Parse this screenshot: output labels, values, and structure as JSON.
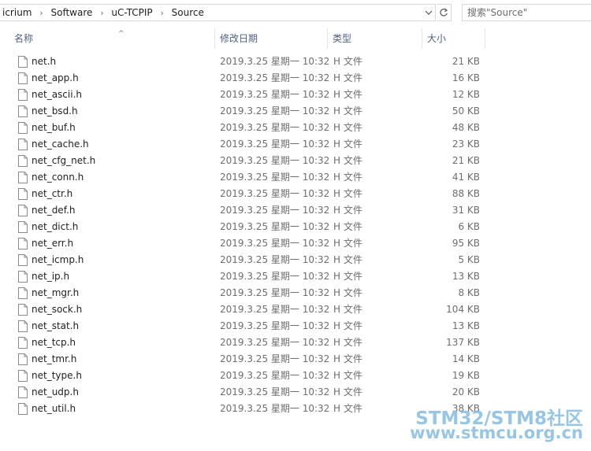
{
  "address_bar": {
    "breadcrumbs": [
      "icrium",
      "Software",
      "uC-TCPIP",
      "Source"
    ]
  },
  "search": {
    "placeholder": "搜索\"Source\""
  },
  "columns": {
    "name": "名称",
    "date": "修改日期",
    "type": "类型",
    "size": "大小"
  },
  "files": [
    {
      "name": "net.h",
      "date": "2019.3.25 星期一 10:32",
      "type": "H 文件",
      "size": "21 KB"
    },
    {
      "name": "net_app.h",
      "date": "2019.3.25 星期一 10:32",
      "type": "H 文件",
      "size": "16 KB"
    },
    {
      "name": "net_ascii.h",
      "date": "2019.3.25 星期一 10:32",
      "type": "H 文件",
      "size": "12 KB"
    },
    {
      "name": "net_bsd.h",
      "date": "2019.3.25 星期一 10:32",
      "type": "H 文件",
      "size": "50 KB"
    },
    {
      "name": "net_buf.h",
      "date": "2019.3.25 星期一 10:32",
      "type": "H 文件",
      "size": "48 KB"
    },
    {
      "name": "net_cache.h",
      "date": "2019.3.25 星期一 10:32",
      "type": "H 文件",
      "size": "23 KB"
    },
    {
      "name": "net_cfg_net.h",
      "date": "2019.3.25 星期一 10:32",
      "type": "H 文件",
      "size": "21 KB"
    },
    {
      "name": "net_conn.h",
      "date": "2019.3.25 星期一 10:32",
      "type": "H 文件",
      "size": "41 KB"
    },
    {
      "name": "net_ctr.h",
      "date": "2019.3.25 星期一 10:32",
      "type": "H 文件",
      "size": "88 KB"
    },
    {
      "name": "net_def.h",
      "date": "2019.3.25 星期一 10:32",
      "type": "H 文件",
      "size": "31 KB"
    },
    {
      "name": "net_dict.h",
      "date": "2019.3.25 星期一 10:32",
      "type": "H 文件",
      "size": "6 KB"
    },
    {
      "name": "net_err.h",
      "date": "2019.3.25 星期一 10:32",
      "type": "H 文件",
      "size": "95 KB"
    },
    {
      "name": "net_icmp.h",
      "date": "2019.3.25 星期一 10:32",
      "type": "H 文件",
      "size": "5 KB"
    },
    {
      "name": "net_ip.h",
      "date": "2019.3.25 星期一 10:32",
      "type": "H 文件",
      "size": "13 KB"
    },
    {
      "name": "net_mgr.h",
      "date": "2019.3.25 星期一 10:32",
      "type": "H 文件",
      "size": "8 KB"
    },
    {
      "name": "net_sock.h",
      "date": "2019.3.25 星期一 10:32",
      "type": "H 文件",
      "size": "104 KB"
    },
    {
      "name": "net_stat.h",
      "date": "2019.3.25 星期一 10:32",
      "type": "H 文件",
      "size": "13 KB"
    },
    {
      "name": "net_tcp.h",
      "date": "2019.3.25 星期一 10:32",
      "type": "H 文件",
      "size": "137 KB"
    },
    {
      "name": "net_tmr.h",
      "date": "2019.3.25 星期一 10:32",
      "type": "H 文件",
      "size": "14 KB"
    },
    {
      "name": "net_type.h",
      "date": "2019.3.25 星期一 10:32",
      "type": "H 文件",
      "size": "19 KB"
    },
    {
      "name": "net_udp.h",
      "date": "2019.3.25 星期一 10:32",
      "type": "H 文件",
      "size": "20 KB"
    },
    {
      "name": "net_util.h",
      "date": "2019.3.25 星期一 10:32",
      "type": "H 文件",
      "size": "38 KB"
    }
  ],
  "watermark": {
    "line1": "STM32/STM8社区",
    "line2": "www.stmcu.org.cn"
  }
}
